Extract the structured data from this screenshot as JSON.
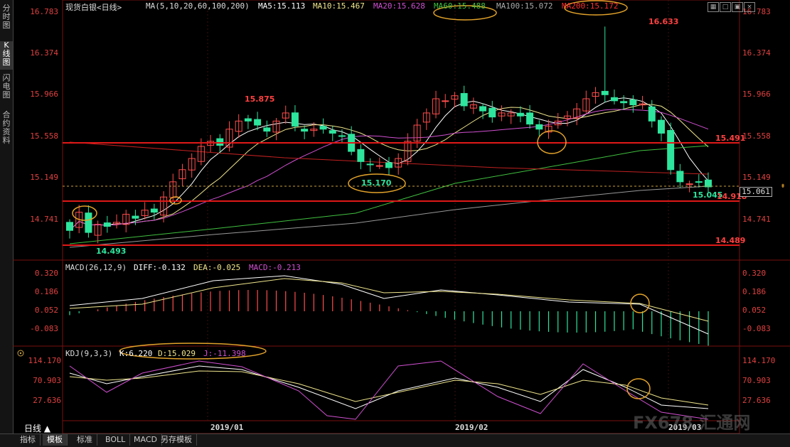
{
  "sidebar": {
    "tabs": [
      {
        "label": "分时图",
        "active": false
      },
      {
        "label": "K线图",
        "active": true
      },
      {
        "label": "闪电图",
        "active": false
      },
      {
        "label": "合约资料",
        "active": false
      }
    ]
  },
  "header": {
    "title": "现货白银<日线>",
    "ma_params": "MA(5,10,20,60,100,200)",
    "ma5": "MA5:15.113",
    "ma10": "MA10:15.467",
    "ma20": "MA20:15.628",
    "ma60": "MA60:15.488",
    "ma100": "MA100:15.072",
    "ma200": "MA200:15.172"
  },
  "toolbar_icons": [
    "grid-icon",
    "window-icon",
    "restore-icon",
    "close-icon"
  ],
  "price_axis": {
    "ticks": [
      "16.783",
      "16.374",
      "15.966",
      "15.558",
      "15.149",
      "14.741"
    ],
    "current_price": "15.061"
  },
  "annotations": {
    "high_label": "16.633",
    "peak_label": "15.875",
    "low_label": "14.493",
    "mid_low_label": "15.170",
    "last_low_label": "15.045",
    "level_upper": "15.491",
    "level_mid": "14.918",
    "level_lower": "14.489"
  },
  "macd": {
    "title": "MACD(26,12,9)",
    "diff": "DIFF:-0.132",
    "dea": "DEA:-0.025",
    "macd": "MACD:-0.213",
    "ticks": [
      "0.320",
      "0.186",
      "0.052",
      "-0.083"
    ]
  },
  "kdj": {
    "title": "KDJ(9,3,3)",
    "k": "K:6.220",
    "d": "D:15.029",
    "j": "J:-11.398",
    "ticks": [
      "114.170",
      "70.903",
      "27.636"
    ]
  },
  "time_axis": [
    "2019/01",
    "2019/02",
    "2019/03"
  ],
  "bottom_bar": {
    "period": "日线 ▲",
    "tabs": [
      "指标",
      "模板",
      "标准",
      "BOLL",
      "MACD",
      "另存模板"
    ],
    "active_tab": "模板"
  },
  "watermark": "FX678 汇通网",
  "colors": {
    "up": "#ff4d4d",
    "down": "#2ee59d",
    "level_line": "#e01818",
    "highlight_circle": "#e3a32a"
  }
}
